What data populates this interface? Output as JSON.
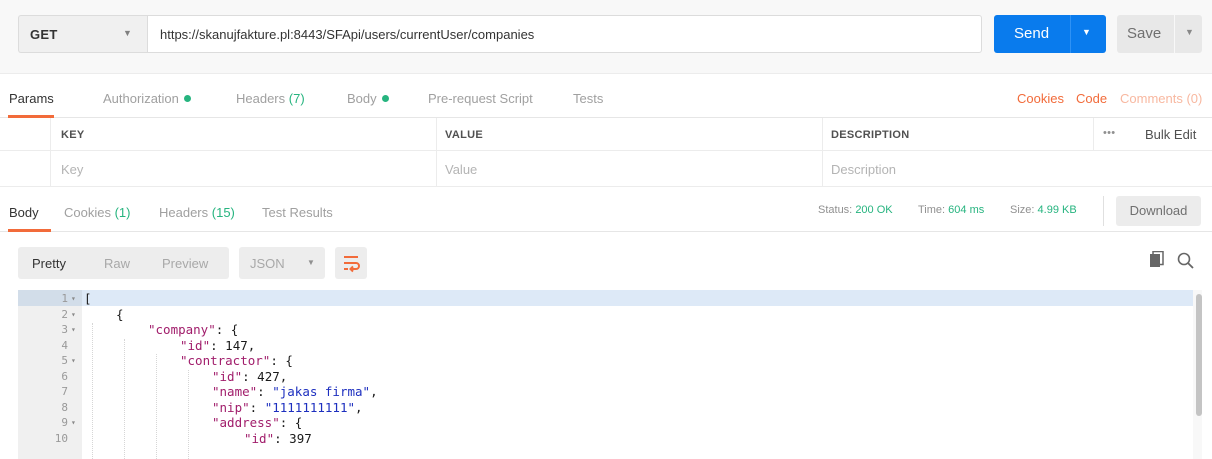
{
  "request": {
    "method": "GET",
    "url": "https://skanujfakture.pl:8443/SFApi/users/currentUser/companies",
    "send_label": "Send",
    "save_label": "Save"
  },
  "request_tabs": {
    "params": "Params",
    "authorization": "Authorization",
    "headers": "Headers",
    "headers_count": "(7)",
    "body": "Body",
    "prerequest": "Pre-request Script",
    "tests": "Tests",
    "cookies": "Cookies",
    "code": "Code",
    "comments": "Comments (0)"
  },
  "params_table": {
    "headers": {
      "key": "KEY",
      "value": "VALUE",
      "description": "DESCRIPTION"
    },
    "more": "•••",
    "bulk_edit": "Bulk Edit",
    "placeholders": {
      "key": "Key",
      "value": "Value",
      "description": "Description"
    }
  },
  "response_tabs": {
    "body": "Body",
    "cookies": "Cookies",
    "cookies_count": "(1)",
    "headers": "Headers",
    "headers_count": "(15)",
    "test_results": "Test Results",
    "status_label": "Status:",
    "status_value": "200 OK",
    "time_label": "Time:",
    "time_value": "604 ms",
    "size_label": "Size:",
    "size_value": "4.99 KB",
    "download": "Download"
  },
  "viewer": {
    "pretty": "Pretty",
    "raw": "Raw",
    "preview": "Preview",
    "format": "JSON"
  },
  "code_lines": [
    {
      "num": "1",
      "fold": true,
      "indent": 0,
      "tokens": [
        {
          "t": "p",
          "v": "["
        }
      ]
    },
    {
      "num": "2",
      "fold": true,
      "indent": 1,
      "tokens": [
        {
          "t": "p",
          "v": "{"
        }
      ]
    },
    {
      "num": "3",
      "fold": true,
      "indent": 2,
      "tokens": [
        {
          "t": "k",
          "v": "\"company\""
        },
        {
          "t": "p",
          "v": ": {"
        }
      ]
    },
    {
      "num": "4",
      "fold": false,
      "indent": 3,
      "tokens": [
        {
          "t": "k",
          "v": "\"id\""
        },
        {
          "t": "p",
          "v": ": "
        },
        {
          "t": "n",
          "v": "147"
        },
        {
          "t": "p",
          "v": ","
        }
      ]
    },
    {
      "num": "5",
      "fold": true,
      "indent": 3,
      "tokens": [
        {
          "t": "k",
          "v": "\"contractor\""
        },
        {
          "t": "p",
          "v": ": {"
        }
      ]
    },
    {
      "num": "6",
      "fold": false,
      "indent": 4,
      "tokens": [
        {
          "t": "k",
          "v": "\"id\""
        },
        {
          "t": "p",
          "v": ": "
        },
        {
          "t": "n",
          "v": "427"
        },
        {
          "t": "p",
          "v": ","
        }
      ]
    },
    {
      "num": "7",
      "fold": false,
      "indent": 4,
      "tokens": [
        {
          "t": "k",
          "v": "\"name\""
        },
        {
          "t": "p",
          "v": ": "
        },
        {
          "t": "s",
          "v": "\"jakas firma\""
        },
        {
          "t": "p",
          "v": ","
        }
      ]
    },
    {
      "num": "8",
      "fold": false,
      "indent": 4,
      "tokens": [
        {
          "t": "k",
          "v": "\"nip\""
        },
        {
          "t": "p",
          "v": ": "
        },
        {
          "t": "s",
          "v": "\"1111111111\""
        },
        {
          "t": "p",
          "v": ","
        }
      ]
    },
    {
      "num": "9",
      "fold": true,
      "indent": 4,
      "tokens": [
        {
          "t": "k",
          "v": "\"address\""
        },
        {
          "t": "p",
          "v": ": {"
        }
      ]
    },
    {
      "num": "10",
      "fold": false,
      "indent": 5,
      "tokens": [
        {
          "t": "k",
          "v": "\"id\""
        },
        {
          "t": "p",
          "v": ": "
        },
        {
          "t": "n",
          "v": "397"
        }
      ]
    }
  ],
  "colors": {
    "accent_orange": "#f26b3a",
    "send_blue": "#097bed",
    "status_green": "#26b47f",
    "json_key": "#a11d6b",
    "json_string": "#1d2fbf"
  },
  "icons": [
    "chevron-down-icon",
    "wrap-lines-icon",
    "copy-icon",
    "search-icon",
    "fold-arrow-icon",
    "status-dot-icon"
  ]
}
